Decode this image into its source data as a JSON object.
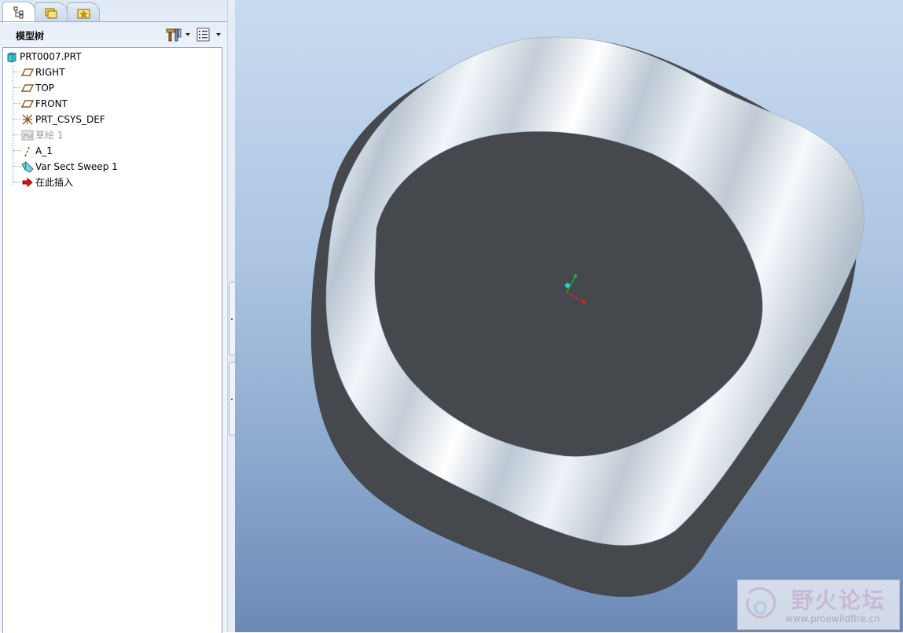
{
  "navigator": {
    "tabs": [
      {
        "id": "model-tree-tab",
        "icon": "model-tree-icon",
        "active": true
      },
      {
        "id": "folder-browser-tab",
        "icon": "folder-browser-icon",
        "active": false
      },
      {
        "id": "favorites-tab",
        "icon": "favorites-icon",
        "active": false
      }
    ],
    "title": "模型树",
    "tools": [
      {
        "id": "settings",
        "icon": "hammer-tools-icon"
      },
      {
        "id": "show",
        "icon": "list-show-icon"
      }
    ],
    "tree": [
      {
        "label": "PRT0007.PRT",
        "icon": "part-icon",
        "dim": false
      },
      {
        "label": "RIGHT",
        "icon": "datum-plane-icon",
        "dim": false
      },
      {
        "label": "TOP",
        "icon": "datum-plane-icon",
        "dim": false
      },
      {
        "label": "FRONT",
        "icon": "datum-plane-icon",
        "dim": false
      },
      {
        "label": "PRT_CSYS_DEF",
        "icon": "csys-icon",
        "dim": false
      },
      {
        "label": "草绘 1",
        "icon": "sketch-icon",
        "dim": true
      },
      {
        "label": "A_1",
        "icon": "datum-axis-icon",
        "dim": false
      },
      {
        "label": "Var Sect Sweep 1",
        "icon": "var-sect-sweep-icon",
        "dim": false
      },
      {
        "label": "在此插入",
        "icon": "insert-here-arrow-icon",
        "dim": false
      }
    ]
  },
  "graphics": {
    "background_top": "#c9dbef",
    "background_bottom": "#6c89b6",
    "model_face_color": "#dfe8f0",
    "model_wall_color": "#45494d",
    "csys_colors": {
      "x": "#e02020",
      "y": "#20c020",
      "z": "#20d0e0"
    }
  },
  "watermark": {
    "title": "野火论坛",
    "url": "www.proewildfire.cn"
  }
}
